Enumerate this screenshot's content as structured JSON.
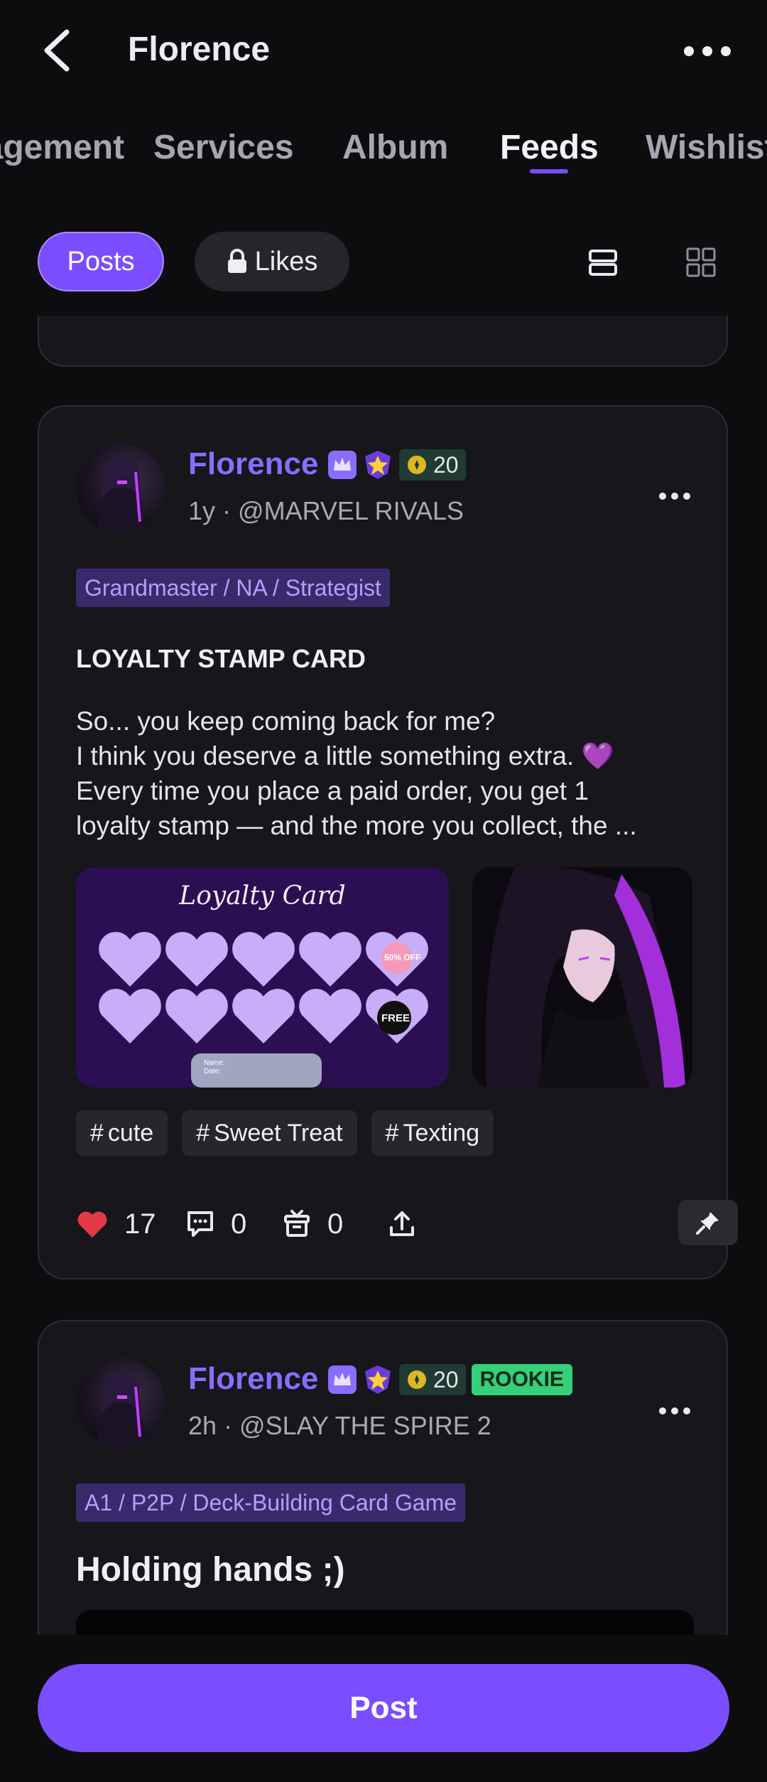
{
  "header": {
    "title": "Florence"
  },
  "tabs": [
    {
      "label": "Engagement"
    },
    {
      "label": "Services"
    },
    {
      "label": "Album"
    },
    {
      "label": "Feeds",
      "active": true
    },
    {
      "label": "Wishlist"
    }
  ],
  "subtabs": {
    "posts_label": "Posts",
    "likes_label": "Likes",
    "likes_locked": true,
    "view_mode": "list"
  },
  "posts": [
    {
      "author": "Florence",
      "level": "20",
      "time": "1y",
      "game": "@MARVEL RIVALS",
      "rank_tag": "Grandmaster / NA / Strategist",
      "title": "LOYALTY STAMP CARD",
      "body": "So... you keep coming back for me?\nI think you deserve a little something extra. 💜\nEvery time you place a paid order, you get 1\nloyalty stamp — and the more you collect, the ...",
      "image_card": {
        "title": "Loyalty Card",
        "name_field": "Name:",
        "date_field": "Date:",
        "discount_label": "50% OFF",
        "free_label": "FREE"
      },
      "hashtags": [
        "cute",
        "Sweet Treat",
        "Texting"
      ],
      "likes": "17",
      "comments": "0",
      "gifts": "0"
    },
    {
      "author": "Florence",
      "level": "20",
      "rookie_label": "ROOKIE",
      "time": "2h",
      "game": "@SLAY THE SPIRE 2",
      "rank_tag": "A1 / P2P / Deck-Building Card Game",
      "title": "Holding hands ;)"
    }
  ],
  "cta": {
    "label": "Post"
  },
  "colors": {
    "accent": "#7b4dff",
    "like": "#e53945",
    "background": "#0d0d10",
    "card": "#16161b"
  }
}
